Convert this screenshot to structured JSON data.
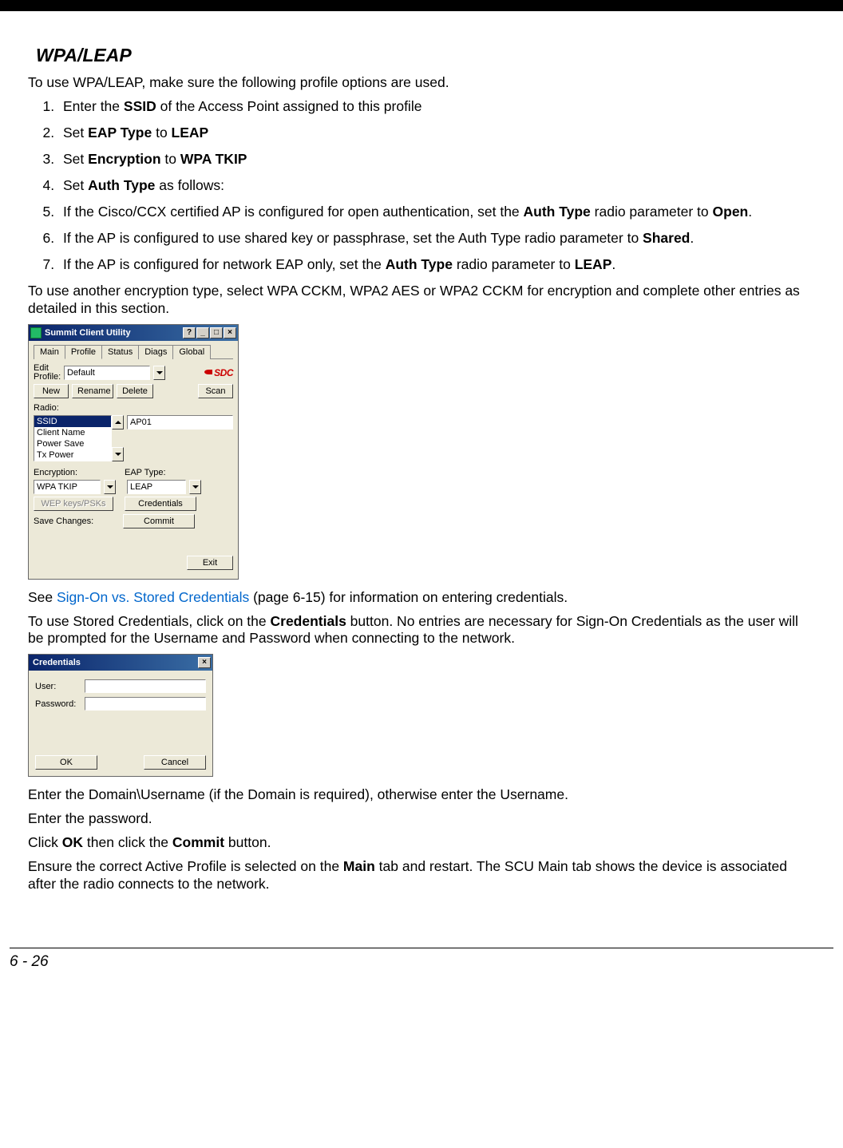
{
  "section_title": "WPA/LEAP",
  "intro": "To use WPA/LEAP, make sure the following profile options are used.",
  "steps": {
    "s1": {
      "pre": "Enter the ",
      "b1": "SSID",
      "post": " of the Access Point assigned to this profile"
    },
    "s2": {
      "pre": "Set ",
      "b1": "EAP Type",
      "mid": " to ",
      "b2": "LEAP"
    },
    "s3": {
      "pre": "Set ",
      "b1": "Encryption",
      "mid": " to ",
      "b2": "WPA TKIP"
    },
    "s4": {
      "pre": "Set ",
      "b1": "Auth Type",
      "post": " as follows:"
    },
    "s5": {
      "pre": "If the Cisco/CCX certified AP is configured for open authentication, set the ",
      "b1": "Auth Type",
      "mid": " radio parameter to ",
      "b2": "Open",
      "post": "."
    },
    "s6": {
      "pre": "If the AP is configured to use shared key or passphrase, set the Auth Type radio parameter to ",
      "b1": "Shared",
      "post": "."
    },
    "s7": {
      "pre": "If the AP is configured for network EAP only, set the ",
      "b1": "Auth Type",
      "mid": " radio parameter to ",
      "b2": "LEAP",
      "post": "."
    }
  },
  "after_steps": "To use another encryption type, select WPA CCKM, WPA2 AES or WPA2 CCKM for encryption and complete other entries as detailed in this section.",
  "scu": {
    "title": "Summit Client Utility",
    "winbtns": {
      "help": "?",
      "min": "_",
      "max": "□",
      "close": "×"
    },
    "tabs": {
      "main": "Main",
      "profile": "Profile",
      "status": "Status",
      "diags": "Diags",
      "global": "Global"
    },
    "edit_profile_label": "Edit Profile:",
    "edit_profile_value": "Default",
    "logo": "SDC",
    "btn_new": "New",
    "btn_rename": "Rename",
    "btn_delete": "Delete",
    "btn_scan": "Scan",
    "radio_label": "Radio:",
    "radio_items": {
      "i0": "SSID",
      "i1": "Client Name",
      "i2": "Power Save",
      "i3": "Tx Power"
    },
    "ssid_value": "AP01",
    "encryption_label": "Encryption:",
    "encryption_value": "WPA TKIP",
    "eap_label": "EAP Type:",
    "eap_value": "LEAP",
    "btn_wep": "WEP keys/PSKs",
    "btn_credentials": "Credentials",
    "save_label": "Save Changes:",
    "btn_commit": "Commit",
    "btn_exit": "Exit"
  },
  "after_scu": {
    "see_pre": "See ",
    "link": "Sign-On vs. Stored Credentials",
    "see_post": " (page 6-15) for information on entering credentials.",
    "p2_pre": "To use Stored Credentials, click on the ",
    "p2_b": "Credentials",
    "p2_post": " button. No entries are necessary for Sign-On Credentials as the user will be prompted for the Username and Password when connecting to the network."
  },
  "cred": {
    "title": "Credentials",
    "close": "×",
    "user_label": "User:",
    "user_value": "",
    "password_label": "Password:",
    "password_value": "",
    "btn_ok": "OK",
    "btn_cancel": "Cancel"
  },
  "after_cred": {
    "p1": "Enter the Domain\\Username (if the Domain is required), otherwise enter the Username.",
    "p2": "Enter the password.",
    "p3_pre": "Click ",
    "p3_b1": "OK",
    "p3_mid": " then click the ",
    "p3_b2": "Commit",
    "p3_post": " button.",
    "p4_pre": "Ensure the correct Active Profile is selected on the ",
    "p4_b": "Main",
    "p4_post": " tab and restart. The SCU Main tab shows the device is associated after the radio connects to the network."
  },
  "footer": "6 - 26"
}
